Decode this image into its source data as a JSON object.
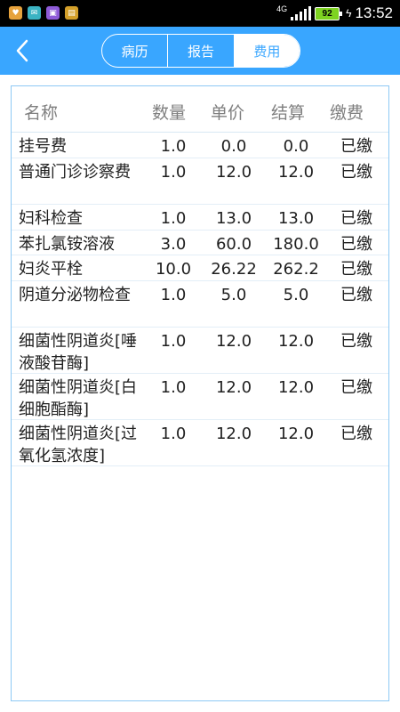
{
  "status_bar": {
    "network": "4G",
    "battery": "92",
    "time": "13:52"
  },
  "header": {
    "tabs": [
      {
        "label": "病历",
        "active": false
      },
      {
        "label": "报告",
        "active": false
      },
      {
        "label": "费用",
        "active": true
      }
    ]
  },
  "table": {
    "columns": [
      "名称",
      "数量",
      "单价",
      "结算",
      "缴费"
    ],
    "rows": [
      {
        "name": "挂号费",
        "qty": "1.0",
        "price": "0.0",
        "settle": "0.0",
        "status": "已缴"
      },
      {
        "name": "普通门诊诊察费",
        "qty": "1.0",
        "price": "12.0",
        "settle": "12.0",
        "status": "已缴"
      },
      {
        "name": "妇科检查",
        "qty": "1.0",
        "price": "13.0",
        "settle": "13.0",
        "status": "已缴"
      },
      {
        "name": "苯扎氯铵溶液",
        "qty": "3.0",
        "price": "60.0",
        "settle": "180.0",
        "status": "已缴"
      },
      {
        "name": "妇炎平栓",
        "qty": "10.0",
        "price": "26.22",
        "settle": "262.2",
        "status": "已缴"
      },
      {
        "name": "阴道分泌物检查",
        "qty": "1.0",
        "price": "5.0",
        "settle": "5.0",
        "status": "已缴"
      },
      {
        "name": "细菌性阴道炎[唾液酸苷酶]",
        "qty": "1.0",
        "price": "12.0",
        "settle": "12.0",
        "status": "已缴"
      },
      {
        "name": "细菌性阴道炎[白细胞酯酶]",
        "qty": "1.0",
        "price": "12.0",
        "settle": "12.0",
        "status": "已缴"
      },
      {
        "name": "细菌性阴道炎[过氧化氢浓度]",
        "qty": "1.0",
        "price": "12.0",
        "settle": "12.0",
        "status": "已缴"
      }
    ]
  },
  "colors": {
    "nav_bar": "#39a6ff",
    "panel_border": "#8ec9f4",
    "header_text": "#7f7f7f"
  }
}
